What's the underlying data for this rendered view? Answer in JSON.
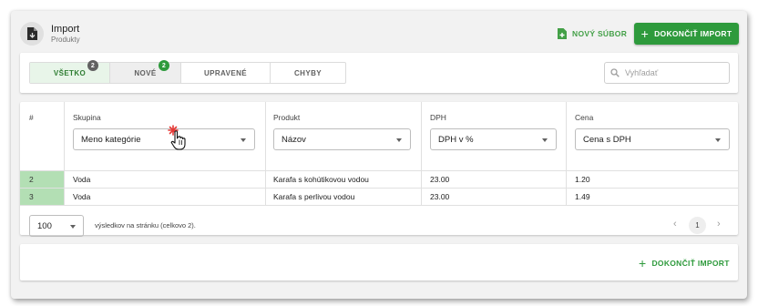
{
  "header": {
    "title": "Import",
    "subtitle": "Produkty",
    "new_file_label": "NOVÝ SÚBOR",
    "finish_label": "DOKONČIŤ IMPORT"
  },
  "tabs": [
    {
      "label": "VŠETKO",
      "badge": "2"
    },
    {
      "label": "NOVÉ",
      "badge": "2"
    },
    {
      "label": "UPRAVENÉ"
    },
    {
      "label": "CHYBY"
    }
  ],
  "search": {
    "placeholder": "Vyhľadať"
  },
  "table": {
    "columns": [
      "#",
      "Skupina",
      "Produkt",
      "DPH",
      "Cena"
    ],
    "selects": [
      "Meno kategórie",
      "Názov",
      "DPH v %",
      "Cena s DPH"
    ],
    "rows": [
      {
        "num": "2",
        "group": "Voda",
        "product": "Karafa s kohútikovou vodou",
        "vat": "23.00",
        "price": "1.20"
      },
      {
        "num": "3",
        "group": "Voda",
        "product": "Karafa s perlivou vodou",
        "vat": "23.00",
        "price": "1.49"
      }
    ]
  },
  "pagination": {
    "per_page": "100",
    "summary": "výsledkov na stránku (celkovo 2).",
    "prev_icon": "‹",
    "next_icon": "›",
    "current_page": "1"
  },
  "footer": {
    "finish_label": "DOKONČIŤ IMPORT"
  },
  "colors": {
    "accent": "#2e9a3c",
    "active_tab_bg": "#e8f5e9",
    "row_number_bg": "#b3dfb4",
    "badge_dark": "#616161",
    "badge_green": "#2e9a3c"
  },
  "icons": {
    "page": "file-icon",
    "new_file": "new-file-icon",
    "add": "plus-icon",
    "search": "search-icon",
    "dropdown": "caret-down-icon",
    "cursor": "hand-pointer-cursor"
  }
}
